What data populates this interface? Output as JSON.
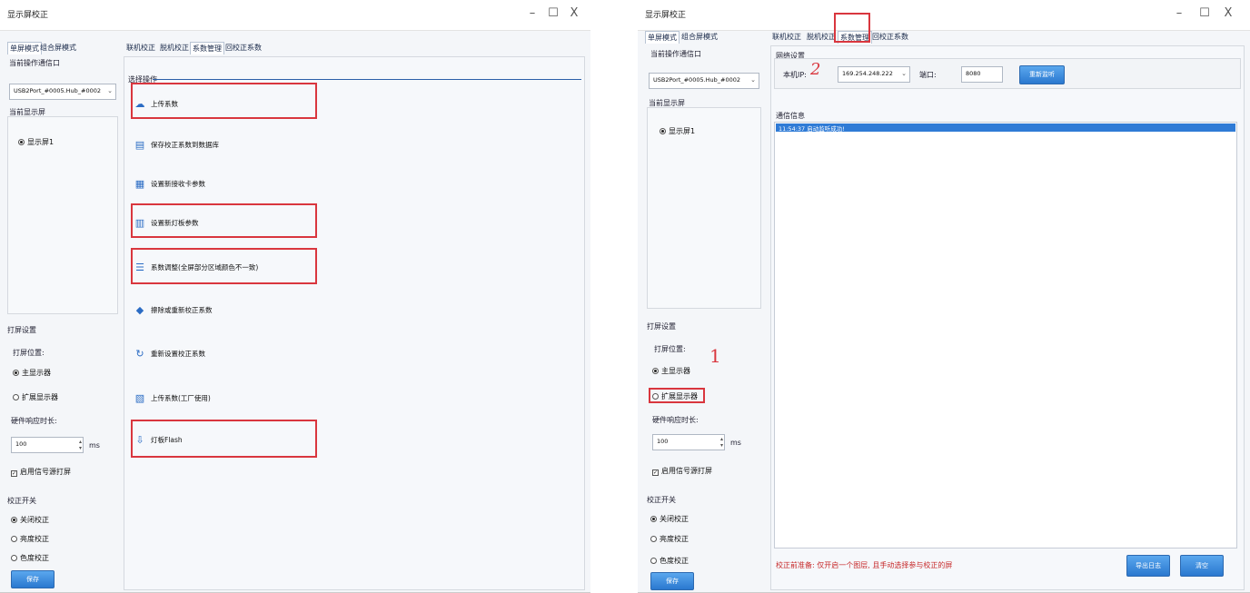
{
  "left": {
    "window_title": "显示屏校正",
    "controls": {
      "min": "–",
      "max": "☐",
      "close": "X"
    },
    "sidebar": {
      "tab_single": "单屏模式",
      "tab_combo": "组合屏模式",
      "channel_label": "当前操作通信口",
      "port_value": "USB2Port_#0005.Hub_#0002",
      "screen_label": "当前显示屏",
      "screen_radio": "显示屏1",
      "print_settings": "打屏设置",
      "print_position": "打屏位置:",
      "main_display": "主显示器",
      "ext_display": "扩展显示器",
      "hw_delay": "硬件响应时长:",
      "delay_value": "100",
      "delay_unit": "ms",
      "enable_signal": "启用信号源打屏",
      "calib_switch": "校正开关",
      "calib_off": "关闭校正",
      "calib_brightness": "亮度校正",
      "calib_color": "色度校正",
      "save_label": "保存"
    },
    "tabs": [
      "联机校正",
      "脱机校正",
      "系数管理",
      "回校正系数"
    ],
    "ops_header": "选择操作",
    "operations": [
      "上传系数",
      "保存校正系数到数据库",
      "设置新接收卡参数",
      "设置新灯板参数",
      "系数调整(全屏部分区域颜色不一致)",
      "擦除或重新校正系数",
      "重新设置校正系数",
      "上传系数(工厂使用)",
      "灯板Flash"
    ]
  },
  "right": {
    "window_title": "显示屏校正",
    "controls": {
      "min": "–",
      "max": "☐",
      "close": "X"
    },
    "sidebar": {
      "tab_single": "单屏模式",
      "tab_combo": "组合屏模式",
      "channel_label": "当前操作通信口",
      "port_value": "USB2Port_#0005.Hub_#0002",
      "screen_label": "当前显示屏",
      "screen_radio": "显示屏1",
      "print_settings": "打屏设置",
      "print_position": "打屏位置:",
      "main_display": "主显示器",
      "ext_display": "扩展显示器",
      "hw_delay": "硬件响应时长:",
      "delay_value": "100",
      "delay_unit": "ms",
      "enable_signal": "启用信号源打屏",
      "calib_switch": "校正开关",
      "calib_off": "关闭校正",
      "calib_brightness": "亮度校正",
      "calib_color": "色度校正",
      "save_label": "保存"
    },
    "tabs": [
      "联机校正",
      "脱机校正",
      "系数管理",
      "回校正系数"
    ],
    "network_label": "网络设置",
    "local_ip_label": "本机IP:",
    "local_ip_value": "169.254.248.222",
    "port_label": "端口:",
    "port_value": "8080",
    "restart_listen": "重新监听",
    "comm_info": "通信信息",
    "log_entry": "11:54:37  启动监听成功!",
    "footer_hint": "校正前准备: 仅开启一个图层, 且手动选择参与校正的屏",
    "export_log": "导出日志",
    "clear_label": "清空"
  },
  "annotations": {
    "num1": "1",
    "num2": "2"
  },
  "colors": {
    "accent_blue": "#2a78cf",
    "highlight_red": "#d9363e",
    "selection_blue": "#2f7bd6"
  }
}
